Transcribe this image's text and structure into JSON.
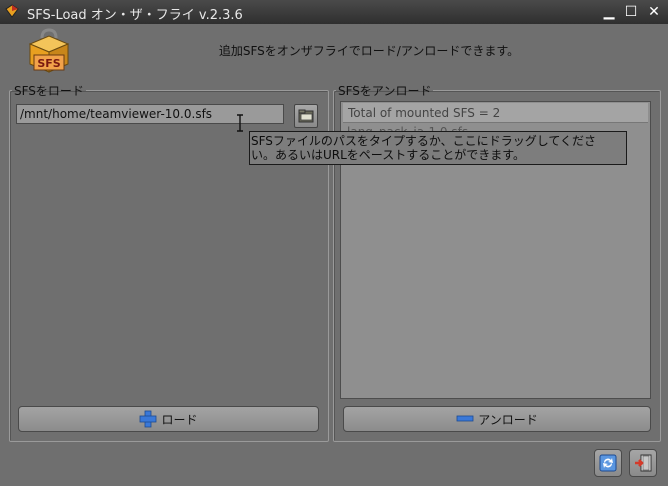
{
  "window": {
    "title": "SFS-Load オン・ザ・フライ v.2.3.6",
    "minimize": "▁",
    "maximize": "☐",
    "close": "✕"
  },
  "header": {
    "logo_label": "SFS",
    "description": "追加SFSをオンザフライでロード/アンロードできます。"
  },
  "load_panel": {
    "legend": "SFSをロード",
    "path_value": "/mnt/home/teamviewer-10.0.sfs",
    "load_button_label": "ロード"
  },
  "unload_panel": {
    "legend": "SFSをアンロード",
    "list_header": "Total of mounted SFS = 2",
    "items": [
      "lang_pack_ja-1.0.sfs"
    ],
    "unload_button_label": "アンロード"
  },
  "tooltip": {
    "line1": "SFSファイルのパスをタイプするか、ここにドラッグしてくださ",
    "line2": "い。あるいはURLをペーストすることができます。"
  },
  "colors": {
    "accent_blue": "#3a78d8",
    "exit_red": "#d43a2a",
    "logo_gold": "#e8a020"
  },
  "icons": [
    "app-icon",
    "sfs-package-icon",
    "folder-icon",
    "text-cursor-icon",
    "plus-icon",
    "minus-icon",
    "refresh-icon",
    "exit-icon"
  ]
}
